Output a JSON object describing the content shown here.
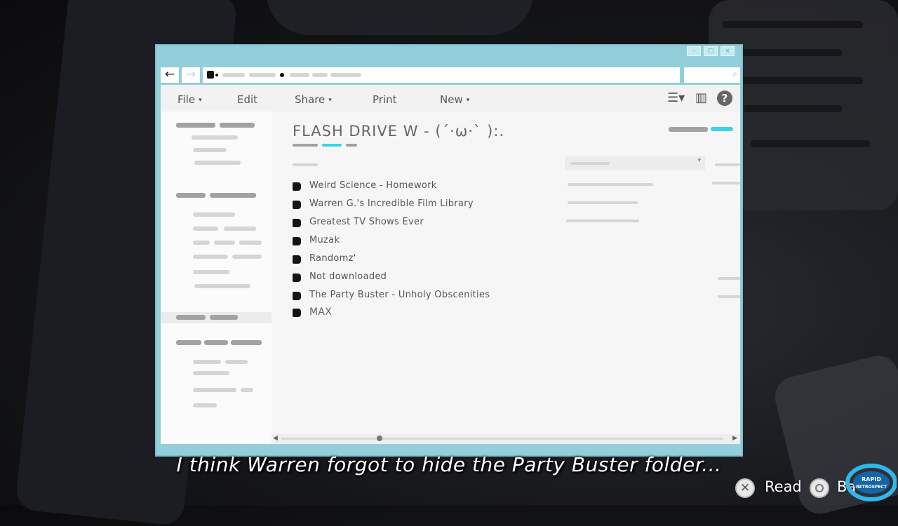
{
  "window": {
    "buttons": [
      "–",
      "□",
      "×"
    ],
    "nav": {
      "back": "←",
      "forward": "→"
    },
    "search_icon": "⌕"
  },
  "toolbar": {
    "file": "File",
    "edit": "Edit",
    "share": "Share",
    "print": "Print",
    "new": "New",
    "caret": "▾",
    "view_icon": "☰▾",
    "pane_icon": "▥",
    "help": "?"
  },
  "main": {
    "title": "FLASH DRIVE W - (ˊ·ω·ˋ ):.",
    "folders": [
      "Weird Science - Homework",
      "Warren G.'s Incredible Film Library",
      "Greatest TV Shows Ever",
      "Muzak",
      "Randomz'",
      "Not downloaded",
      "The Party Buster - Unholy Obscenities",
      "MAX"
    ]
  },
  "subtitle": "I think Warren forgot to hide the Party Buster folder...",
  "prompts": {
    "read_label": "Read",
    "back_label": "Ba"
  },
  "watermark_text": "RAPID RETROSPECT",
  "colors": {
    "window_frame": "#92cfdb",
    "accent": "#3ed2e6"
  }
}
